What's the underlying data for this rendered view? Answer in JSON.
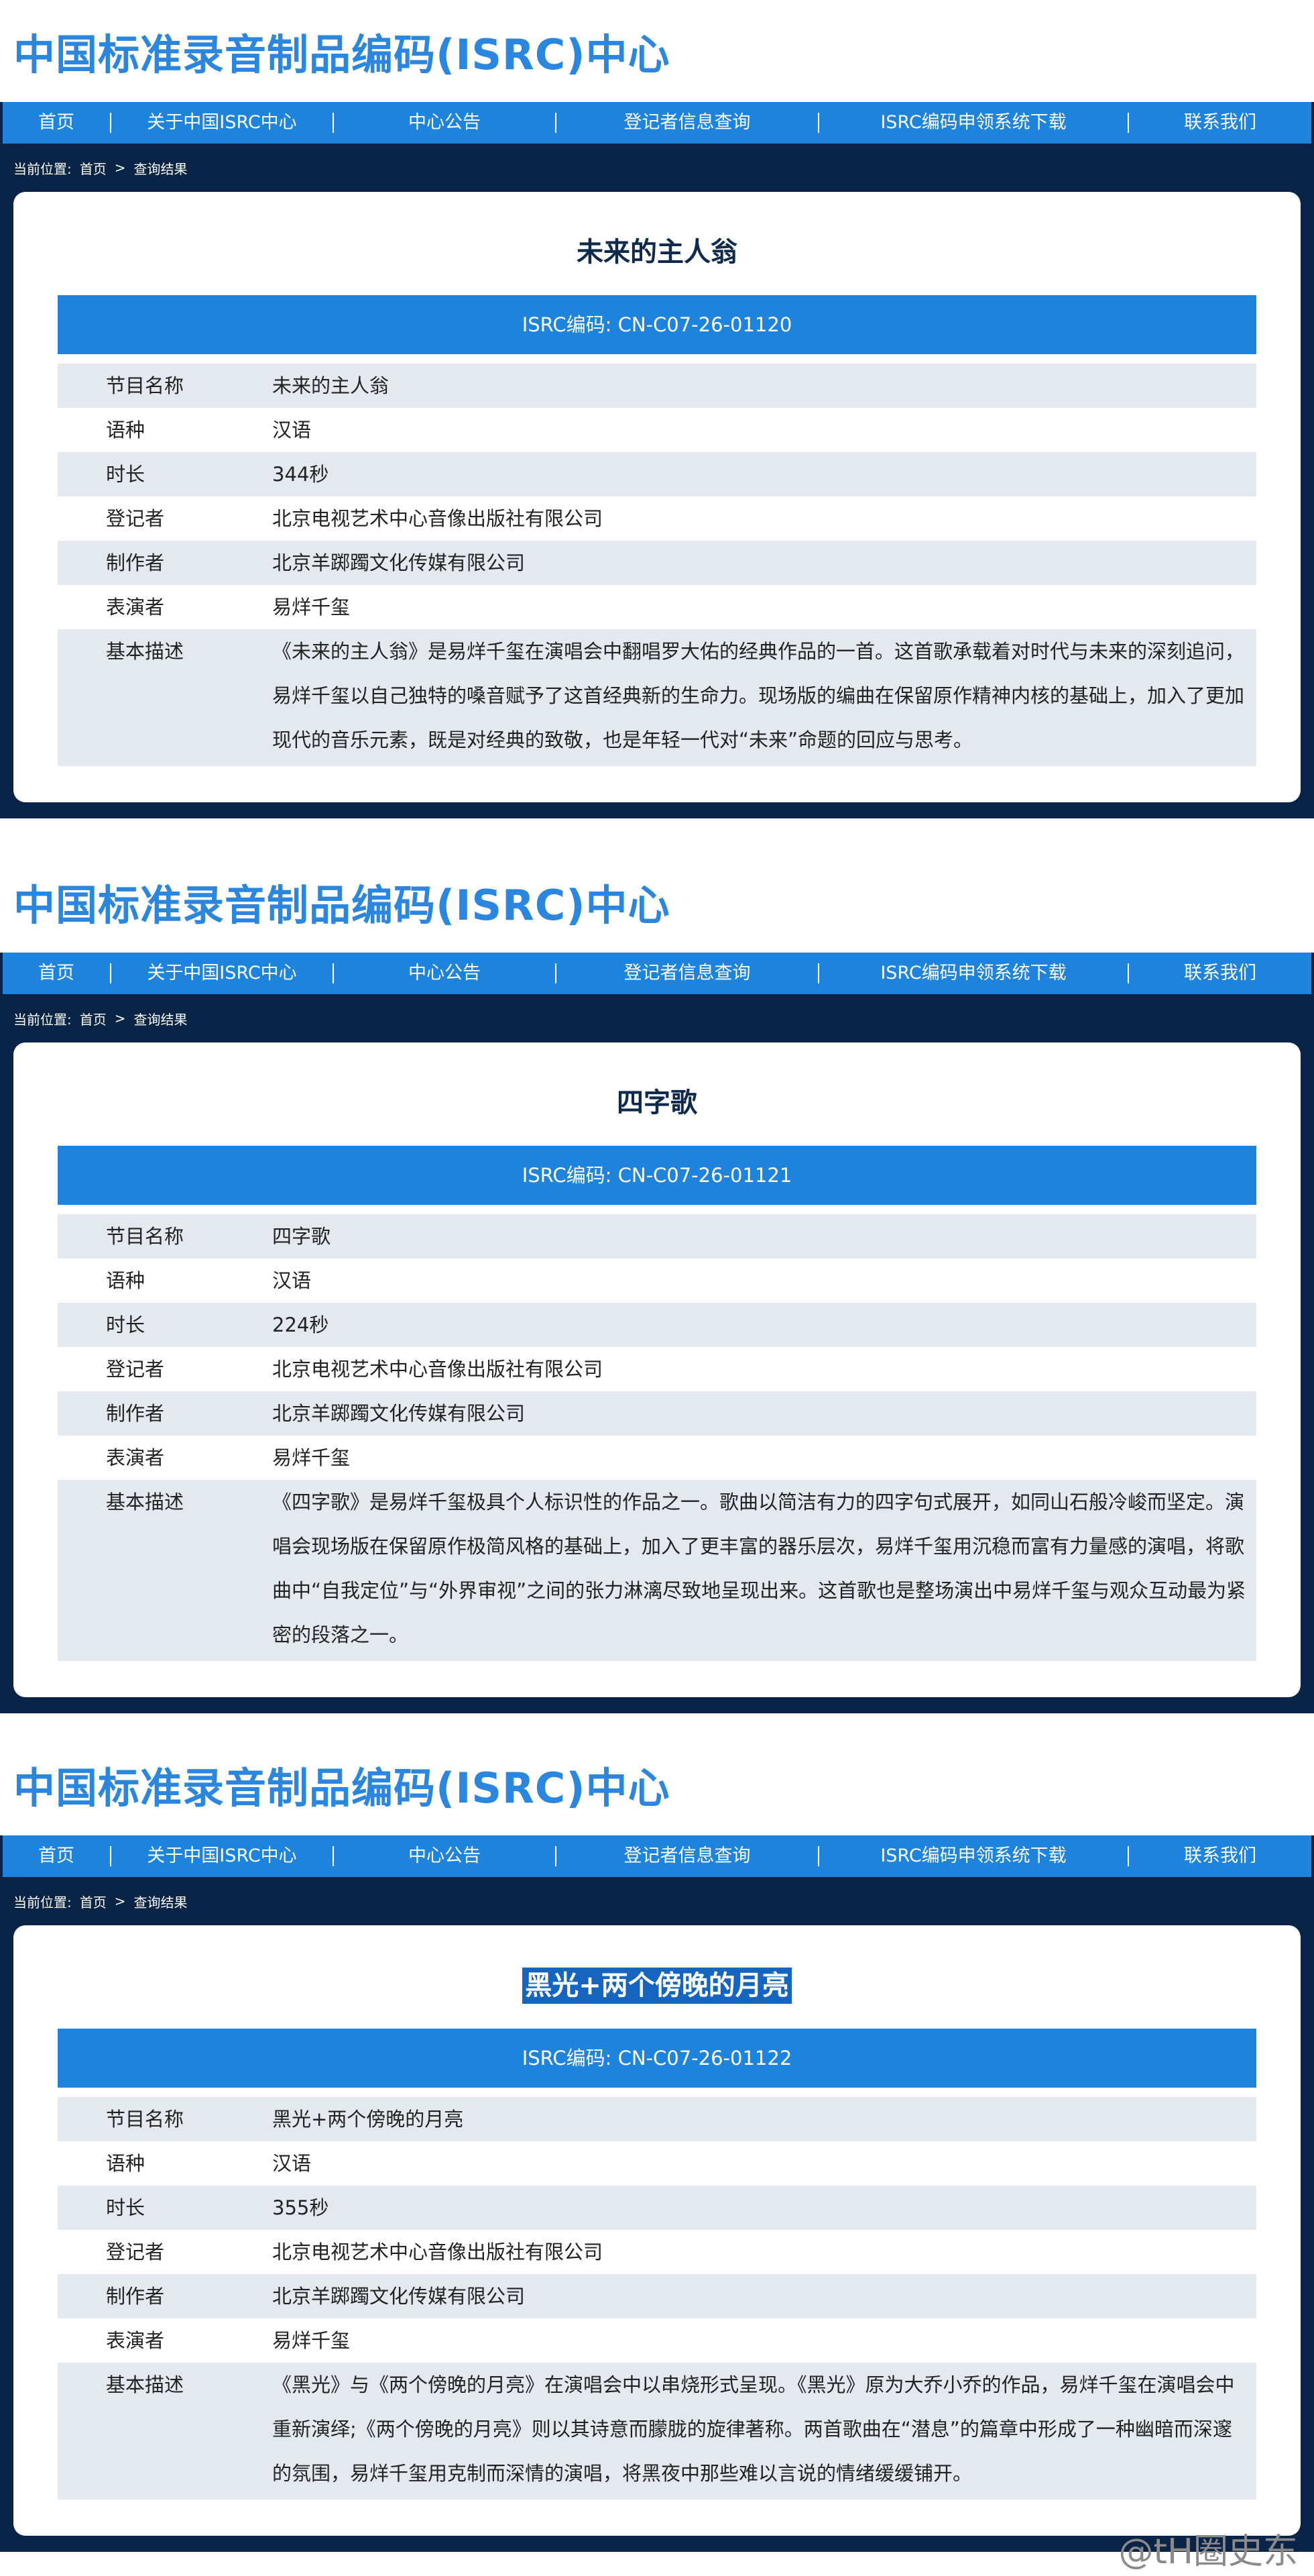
{
  "site_title": "中国标准录音制品编码(ISRC)中心",
  "nav": [
    "首页",
    "关于中国ISRC中心",
    "中心公告",
    "登记者信息查询",
    "ISRC编码申领系统下载",
    "联系我们"
  ],
  "breadcrumb": {
    "prefix": "当前位置:",
    "home": "首页",
    "sep": ">",
    "current": "查询结果"
  },
  "labels": {
    "name": "节目名称",
    "language": "语种",
    "duration": "时长",
    "registrant": "登记者",
    "producer": "制作者",
    "performer": "表演者",
    "description": "基本描述"
  },
  "records": [
    {
      "title": "未来的主人翁",
      "isrc": "ISRC编码: CN-C07-26-01120",
      "name": "未来的主人翁",
      "language": "汉语",
      "duration": "344秒",
      "registrant": "北京电视艺术中心音像出版社有限公司",
      "producer": "北京羊踯躅文化传媒有限公司",
      "performer": "易烊千玺",
      "description": "《未来的主人翁》是易烊千玺在演唱会中翻唱罗大佑的经典作品的一首。这首歌承载着对时代与未来的深刻追问，易烊千玺以自己独特的嗓音赋予了这首经典新的生命力。现场版的编曲在保留原作精神内核的基础上，加入了更加现代的音乐元素，既是对经典的致敬，也是年轻一代对“未来”命题的回应与思考。"
    },
    {
      "title": "四字歌",
      "isrc": "ISRC编码: CN-C07-26-01121",
      "name": "四字歌",
      "language": "汉语",
      "duration": "224秒",
      "registrant": "北京电视艺术中心音像出版社有限公司",
      "producer": "北京羊踯躅文化传媒有限公司",
      "performer": "易烊千玺",
      "description": "《四字歌》是易烊千玺极具个人标识性的作品之一。歌曲以简洁有力的四字句式展开，如同山石般冷峻而坚定。演唱会现场版在保留原作极简风格的基础上，加入了更丰富的器乐层次，易烊千玺用沉稳而富有力量感的演唱，将歌曲中“自我定位”与“外界审视”之间的张力淋漓尽致地呈现出来。这首歌也是整场演出中易烊千玺与观众互动最为紧密的段落之一。"
    },
    {
      "title": "黑光+两个傍晚的月亮",
      "isrc": "ISRC编码: CN-C07-26-01122",
      "name": "黑光+两个傍晚的月亮",
      "language": "汉语",
      "duration": "355秒",
      "registrant": "北京电视艺术中心音像出版社有限公司",
      "producer": "北京羊踯躅文化传媒有限公司",
      "performer": "易烊千玺",
      "description": "《黑光》与《两个傍晚的月亮》在演唱会中以串烧形式呈现。《黑光》原为大乔小乔的作品，易烊千玺在演唱会中重新演绎;《两个傍晚的月亮》则以其诗意而朦胧的旋律著称。两首歌曲在“潜息”的篇章中形成了一种幽暗而深邃的氛围，易烊千玺用克制而深情的演唱，将黑夜中那些难以言说的情绪缓缓铺开。"
    }
  ],
  "watermark": "@tH圈史东"
}
